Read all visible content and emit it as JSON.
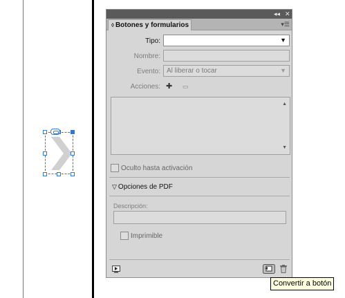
{
  "panel": {
    "title": "Botones y formularios",
    "tab_icon": "up-down-arrows-icon",
    "collapse_icon": "double-chevron-icon",
    "close_icon": "close-icon",
    "menu_icon": "panel-menu-icon",
    "collapse_glyph": "◂◂",
    "close_glyph": "✕",
    "menu_glyph": "▾☰"
  },
  "form": {
    "tipo_label": "Tipo:",
    "tipo_value": "",
    "nombre_label": "Nombre:",
    "nombre_value": "",
    "evento_label": "Evento:",
    "evento_value": "Al liberar o tocar",
    "acciones_label": "Acciones:",
    "add_action_glyph": "✚",
    "remove_action_glyph": "▭"
  },
  "options": {
    "hidden_until_activated": "Oculto hasta activación",
    "pdf_section": "Opciones de PDF",
    "description_label": "Descripción:",
    "description_value": "",
    "printable": "Imprimible"
  },
  "footer": {
    "preview_icon": "preview-icon",
    "convert_icon": "convert-to-button-icon",
    "delete_icon": "trash-icon"
  },
  "tooltip": {
    "text": "Convertir a botón"
  },
  "colors": {
    "selection": "#2e78d6",
    "margin_guide": "#b24bb5",
    "panel_bg": "#d6d6d6",
    "tooltip_bg": "#ffffe1"
  }
}
